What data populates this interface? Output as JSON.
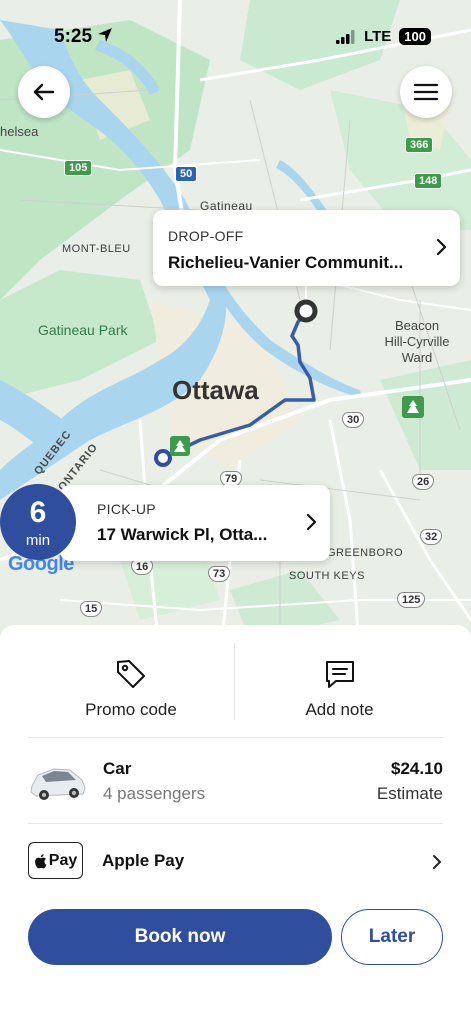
{
  "status_bar": {
    "time": "5:25",
    "network": "LTE",
    "battery": "100"
  },
  "map": {
    "city": "Ottawa",
    "labels": {
      "chelsea": "helsea",
      "mont_bleu": "MONT-BLEU",
      "gatineau_park": "Gatineau Park",
      "beacon_hill_1": "Beacon",
      "beacon_hill_2": "Hill-Cyrville",
      "beacon_hill_3": "Ward",
      "quebec": "QUEBEC",
      "ontario": "ONTARIO",
      "greenboro": "GREENBORO",
      "south_keys": "SOUTH KEYS",
      "gatineau_partial": "Gatineau"
    },
    "shields": {
      "r105": "105",
      "r50": "50",
      "r366": "366",
      "r148": "148",
      "r30": "30",
      "r79": "79",
      "r26": "26",
      "r32": "32",
      "r16": "16",
      "r73": "73",
      "r15": "15",
      "r125": "125"
    }
  },
  "dropoff": {
    "label": "DROP-OFF",
    "address": "Richelieu-Vanier Communit..."
  },
  "pickup": {
    "label": "PICK-UP",
    "address": "17 Warwick Pl, Otta..."
  },
  "eta": {
    "value": "6",
    "unit": "min"
  },
  "attribution": "Google",
  "actions": {
    "promo": "Promo code",
    "note": "Add note"
  },
  "ride": {
    "name": "Car",
    "passengers": "4 passengers",
    "price": "$24.10",
    "estimate": "Estimate"
  },
  "payment": {
    "icon_text": "Pay",
    "label": "Apple Pay"
  },
  "buttons": {
    "book": "Book now",
    "later": "Later"
  },
  "colors": {
    "accent": "#2f4f9e",
    "route": "#3a5ca8",
    "water": "#a5d4f0",
    "park": "#b7e2bf"
  }
}
